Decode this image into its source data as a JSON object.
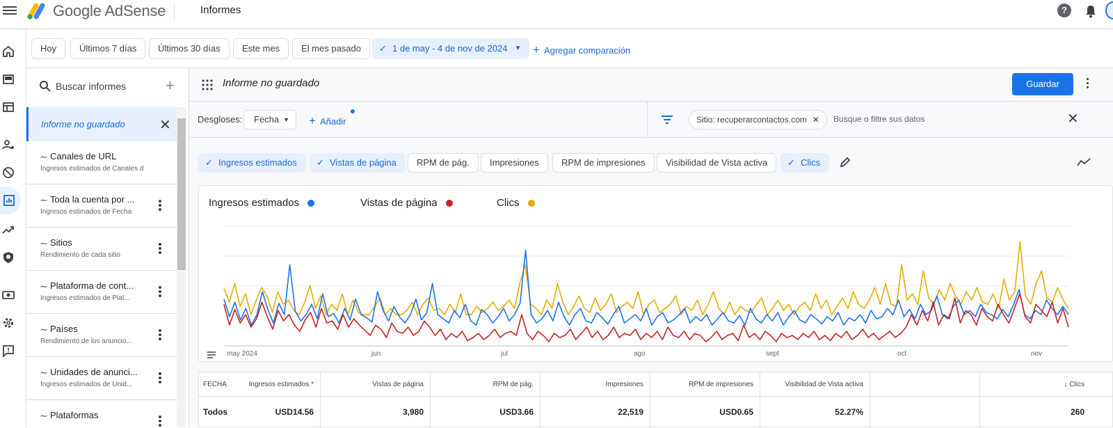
{
  "app": {
    "brand": "Google AdSense",
    "section": "Informes"
  },
  "date_filters": {
    "hoy": "Hoy",
    "ultimos7": "Últimos 7 días",
    "ultimos30": "Últimos 30 días",
    "este_mes": "Este mes",
    "mes_pasado": "El mes pasado",
    "rango": "1 de may - 4 de nov de 2024",
    "comparacion": "Agregar comparación"
  },
  "sidebar": {
    "search_label": "Buscar informes",
    "selected": "Informe no guardado",
    "reports": [
      {
        "title": "Canales de URL",
        "subtitle": "Ingresos estimados de Canales de U..."
      },
      {
        "title": "Toda la cuenta por ...",
        "subtitle": "Ingresos estimados de Fecha"
      },
      {
        "title": "Sitios",
        "subtitle": "Rendimiento de cada sitio"
      },
      {
        "title": "Plataforma de cont...",
        "subtitle": "Ingresos estimados de Plat..."
      },
      {
        "title": "Países",
        "subtitle": "Rendimiento de los anuncio..."
      },
      {
        "title": "Unidades de anunci...",
        "subtitle": "Ingresos estimados de Unid..."
      },
      {
        "title": "Plataformas",
        "subtitle": ""
      }
    ]
  },
  "report": {
    "title": "Informe no guardado",
    "save": "Guardar",
    "breakdowns_label": "Desgloses:",
    "breakdown_value": "Fecha",
    "add": "Añadir",
    "site_filter": "Sitio: recuperarcontactos.com",
    "filter_placeholder": "Busque o filtre sus datos"
  },
  "metric_chips": [
    {
      "label": "Ingresos estimados",
      "selected": true
    },
    {
      "label": "Vistas de página",
      "selected": true
    },
    {
      "label": "RPM de pág.",
      "selected": false
    },
    {
      "label": "Impresiones",
      "selected": false
    },
    {
      "label": "RPM de impresiones",
      "selected": false
    },
    {
      "label": "Visibilidad de Vista activa",
      "selected": false
    },
    {
      "label": "Clics",
      "selected": true
    }
  ],
  "colors": {
    "blue": "#1a73e8",
    "red": "#c5221f",
    "yellow": "#e8ab00",
    "accent": "#1a73e8"
  },
  "chart_data": {
    "type": "line",
    "x_labels": [
      "may 2024",
      "jun",
      "jul",
      "ago",
      "sept",
      "oct",
      "nov"
    ],
    "series": [
      {
        "name": "Ingresos estimados",
        "color": "#1a73e8",
        "values": [
          0.45,
          0.28,
          0.42,
          0.25,
          0.36,
          0.2,
          0.3,
          0.52,
          0.35,
          0.22,
          0.41,
          0.3,
          0.78,
          0.33,
          0.24,
          0.3,
          0.4,
          0.26,
          0.5,
          0.28,
          0.31,
          0.22,
          0.36,
          0.25,
          0.45,
          0.3,
          0.27,
          0.23,
          0.52,
          0.34,
          0.24,
          0.38,
          0.28,
          0.22,
          0.3,
          0.45,
          0.25,
          0.32,
          0.6,
          0.3,
          0.26,
          0.22,
          0.34,
          0.27,
          0.4,
          0.24,
          0.2,
          0.35,
          0.3,
          0.22,
          0.28,
          0.36,
          0.24,
          0.3,
          0.41,
          0.92,
          0.3,
          0.22,
          0.26,
          0.34,
          0.24,
          0.42,
          0.28,
          0.2,
          0.3,
          0.36,
          0.24,
          0.22,
          0.32,
          0.27,
          0.21,
          0.3,
          0.38,
          0.22,
          0.26,
          0.3,
          0.24,
          0.36,
          0.2,
          0.28,
          0.32,
          0.22,
          0.25,
          0.3,
          0.36,
          0.22,
          0.28,
          0.24,
          0.3,
          0.2,
          0.26,
          0.32,
          0.24,
          0.22,
          0.29,
          0.2,
          0.36,
          0.26,
          0.22,
          0.3,
          0.24,
          0.32,
          0.2,
          0.28,
          0.34,
          0.25,
          0.22,
          0.3,
          0.26,
          0.21,
          0.28,
          0.24,
          0.32,
          0.2,
          0.27,
          0.24,
          0.3,
          0.22,
          0.34,
          0.26,
          0.28,
          0.36,
          0.3,
          0.44,
          0.28,
          0.35,
          0.26,
          0.4,
          0.3,
          0.34,
          0.48,
          0.3,
          0.26,
          0.38,
          0.44,
          0.3,
          0.34,
          0.28,
          0.4,
          0.32,
          0.3,
          0.26,
          0.35,
          0.28,
          0.4,
          0.54,
          0.3,
          0.26,
          0.34,
          0.3,
          0.44,
          0.36,
          0.3,
          0.38,
          0.3
        ]
      },
      {
        "name": "Vistas de página",
        "color": "#c5221f",
        "values": [
          0.4,
          0.2,
          0.35,
          0.22,
          0.3,
          0.18,
          0.26,
          0.42,
          0.28,
          0.16,
          0.34,
          0.24,
          0.3,
          0.2,
          0.14,
          0.25,
          0.32,
          0.18,
          0.36,
          0.22,
          0.24,
          0.16,
          0.3,
          0.18,
          0.26,
          0.2,
          0.15,
          0.1,
          0.2,
          0.16,
          0.08,
          0.22,
          0.14,
          0.12,
          0.18,
          0.1,
          0.14,
          0.24,
          0.18,
          0.1,
          0.16,
          0.06,
          0.12,
          0.08,
          0.14,
          0.05,
          0.08,
          0.12,
          0.06,
          0.1,
          0.16,
          0.08,
          0.12,
          0.14,
          0.1,
          0.3,
          0.12,
          0.06,
          0.14,
          0.1,
          0.04,
          0.12,
          0.08,
          0.1,
          0.16,
          0.06,
          0.12,
          0.18,
          0.08,
          0.14,
          0.06,
          0.1,
          0.18,
          0.08,
          0.12,
          0.1,
          0.16,
          0.06,
          0.12,
          0.08,
          0.14,
          0.06,
          0.18,
          0.1,
          0.08,
          0.14,
          0.06,
          0.12,
          0.1,
          0.04,
          0.08,
          0.14,
          0.06,
          0.1,
          0.12,
          0.05,
          0.2,
          0.08,
          0.12,
          0.06,
          0.14,
          0.1,
          0.04,
          0.12,
          0.08,
          0.1,
          0.06,
          0.12,
          0.08,
          0.14,
          0.06,
          0.1,
          0.05,
          0.12,
          0.08,
          0.14,
          0.06,
          0.1,
          0.16,
          0.08,
          0.12,
          0.06,
          0.1,
          0.14,
          0.08,
          0.12,
          0.18,
          0.3,
          0.2,
          0.34,
          0.24,
          0.42,
          0.2,
          0.3,
          0.26,
          0.46,
          0.22,
          0.34,
          0.3,
          0.2,
          0.36,
          0.28,
          0.24,
          0.4,
          0.3,
          0.22,
          0.36,
          0.5,
          0.28,
          0.22,
          0.4,
          0.34,
          0.28,
          0.42,
          0.22,
          0.36,
          0.18
        ]
      },
      {
        "name": "Clics",
        "color": "#e8ab00",
        "values": [
          0.55,
          0.42,
          0.6,
          0.38,
          0.5,
          0.3,
          0.44,
          0.56,
          0.48,
          0.32,
          0.52,
          0.4,
          0.44,
          0.34,
          0.3,
          0.42,
          0.58,
          0.36,
          0.48,
          0.3,
          0.4,
          0.34,
          0.5,
          0.3,
          0.44,
          0.32,
          0.3,
          0.3,
          0.38,
          0.46,
          0.3,
          0.36,
          0.3,
          0.3,
          0.34,
          0.42,
          0.3,
          0.4,
          0.46,
          0.34,
          0.36,
          0.3,
          0.4,
          0.32,
          0.5,
          0.3,
          0.3,
          0.38,
          0.32,
          0.36,
          0.42,
          0.34,
          0.38,
          0.44,
          0.36,
          0.6,
          0.78,
          0.4,
          0.36,
          0.3,
          0.44,
          0.36,
          0.6,
          0.42,
          0.3,
          0.38,
          0.48,
          0.36,
          0.32,
          0.46,
          0.34,
          0.4,
          0.5,
          0.32,
          0.38,
          0.42,
          0.36,
          0.52,
          0.3,
          0.4,
          0.44,
          0.32,
          0.36,
          0.4,
          0.48,
          0.3,
          0.38,
          0.34,
          0.44,
          0.3,
          0.4,
          0.52,
          0.36,
          0.3,
          0.42,
          0.3,
          0.38,
          0.34,
          0.32,
          0.4,
          0.46,
          0.3,
          0.36,
          0.44,
          0.34,
          0.4,
          0.3,
          0.38,
          0.42,
          0.34,
          0.5,
          0.36,
          0.44,
          0.3,
          0.38,
          0.46,
          0.36,
          0.52,
          0.4,
          0.36,
          0.44,
          0.56,
          0.4,
          0.6,
          0.4,
          0.38,
          0.78,
          0.44,
          0.5,
          0.4,
          0.72,
          0.46,
          0.4,
          0.54,
          0.44,
          0.6,
          0.48,
          0.4,
          0.52,
          0.44,
          0.56,
          0.42,
          0.4,
          0.5,
          0.36,
          0.64,
          0.44,
          0.52,
          1.0,
          0.48,
          0.4,
          0.6,
          0.72,
          0.46,
          0.42,
          0.56,
          0.44,
          0.36
        ]
      }
    ],
    "ylim": [
      0,
      1.15
    ],
    "grid": true
  },
  "table": {
    "headers": [
      "FECHA",
      "Ingresos estimados *",
      "Vistas de página",
      "RPM de pág.",
      "Impresiones",
      "RPM de impresiones",
      "Visibilidad de Vista activa",
      "Clics"
    ],
    "total_row": [
      "Todos",
      "USD14.56",
      "3,980",
      "USD3.66",
      "22,519",
      "USD0.65",
      "52.27%",
      "260"
    ]
  }
}
